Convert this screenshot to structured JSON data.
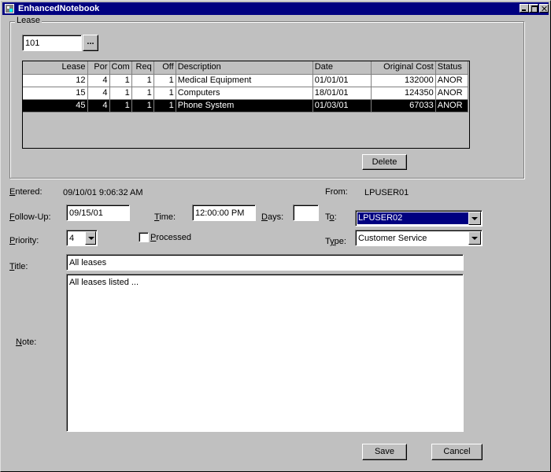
{
  "window": {
    "title": "EnhancedNotebook"
  },
  "lease_group": {
    "label": "Lease",
    "lease_value": "101",
    "browse_label": "...",
    "delete_label": "Delete",
    "columns": [
      "Lease",
      "Por",
      "Com",
      "Req",
      "Off",
      "Description",
      "Date",
      "Original Cost",
      "Status"
    ],
    "rows": [
      {
        "lease": "12",
        "por": "4",
        "com": "1",
        "req": "1",
        "off": "1",
        "description": "Medical Equipment",
        "date": "01/01/01",
        "cost": "132000",
        "status": "ANOR",
        "selected": false
      },
      {
        "lease": "15",
        "por": "4",
        "com": "1",
        "req": "1",
        "off": "1",
        "description": "Computers",
        "date": "18/01/01",
        "cost": "124350",
        "status": "ANOR",
        "selected": false
      },
      {
        "lease": "45",
        "por": "4",
        "com": "1",
        "req": "1",
        "off": "1",
        "description": "Phone System",
        "date": "01/03/01",
        "cost": "67033",
        "status": "ANOR",
        "selected": true
      }
    ]
  },
  "form": {
    "entered_label": "Entered:",
    "entered_value": "09/10/01 9:06:32 AM",
    "from_label": "From:",
    "from_value": "LPUSER01",
    "followup_label": "Follow-Up:",
    "followup_value": "09/15/01",
    "time_label": "Time:",
    "time_value": "12:00:00 PM",
    "days_label": "Days:",
    "days_value": "",
    "to_label": "To:",
    "to_value": "LPUSER02",
    "priority_label": "Priority:",
    "priority_value": "4",
    "processed_label": "Processed",
    "processed_checked": false,
    "type_label": "Type:",
    "type_value": "Customer Service",
    "title_label": "Title:",
    "title_value": "All leases",
    "note_label": "Note:",
    "note_value": "All leases listed ..."
  },
  "buttons": {
    "save": "Save",
    "cancel": "Cancel"
  },
  "colors": {
    "titlebar": "#000080",
    "face": "#c0c0c0",
    "selection": "#000080"
  }
}
